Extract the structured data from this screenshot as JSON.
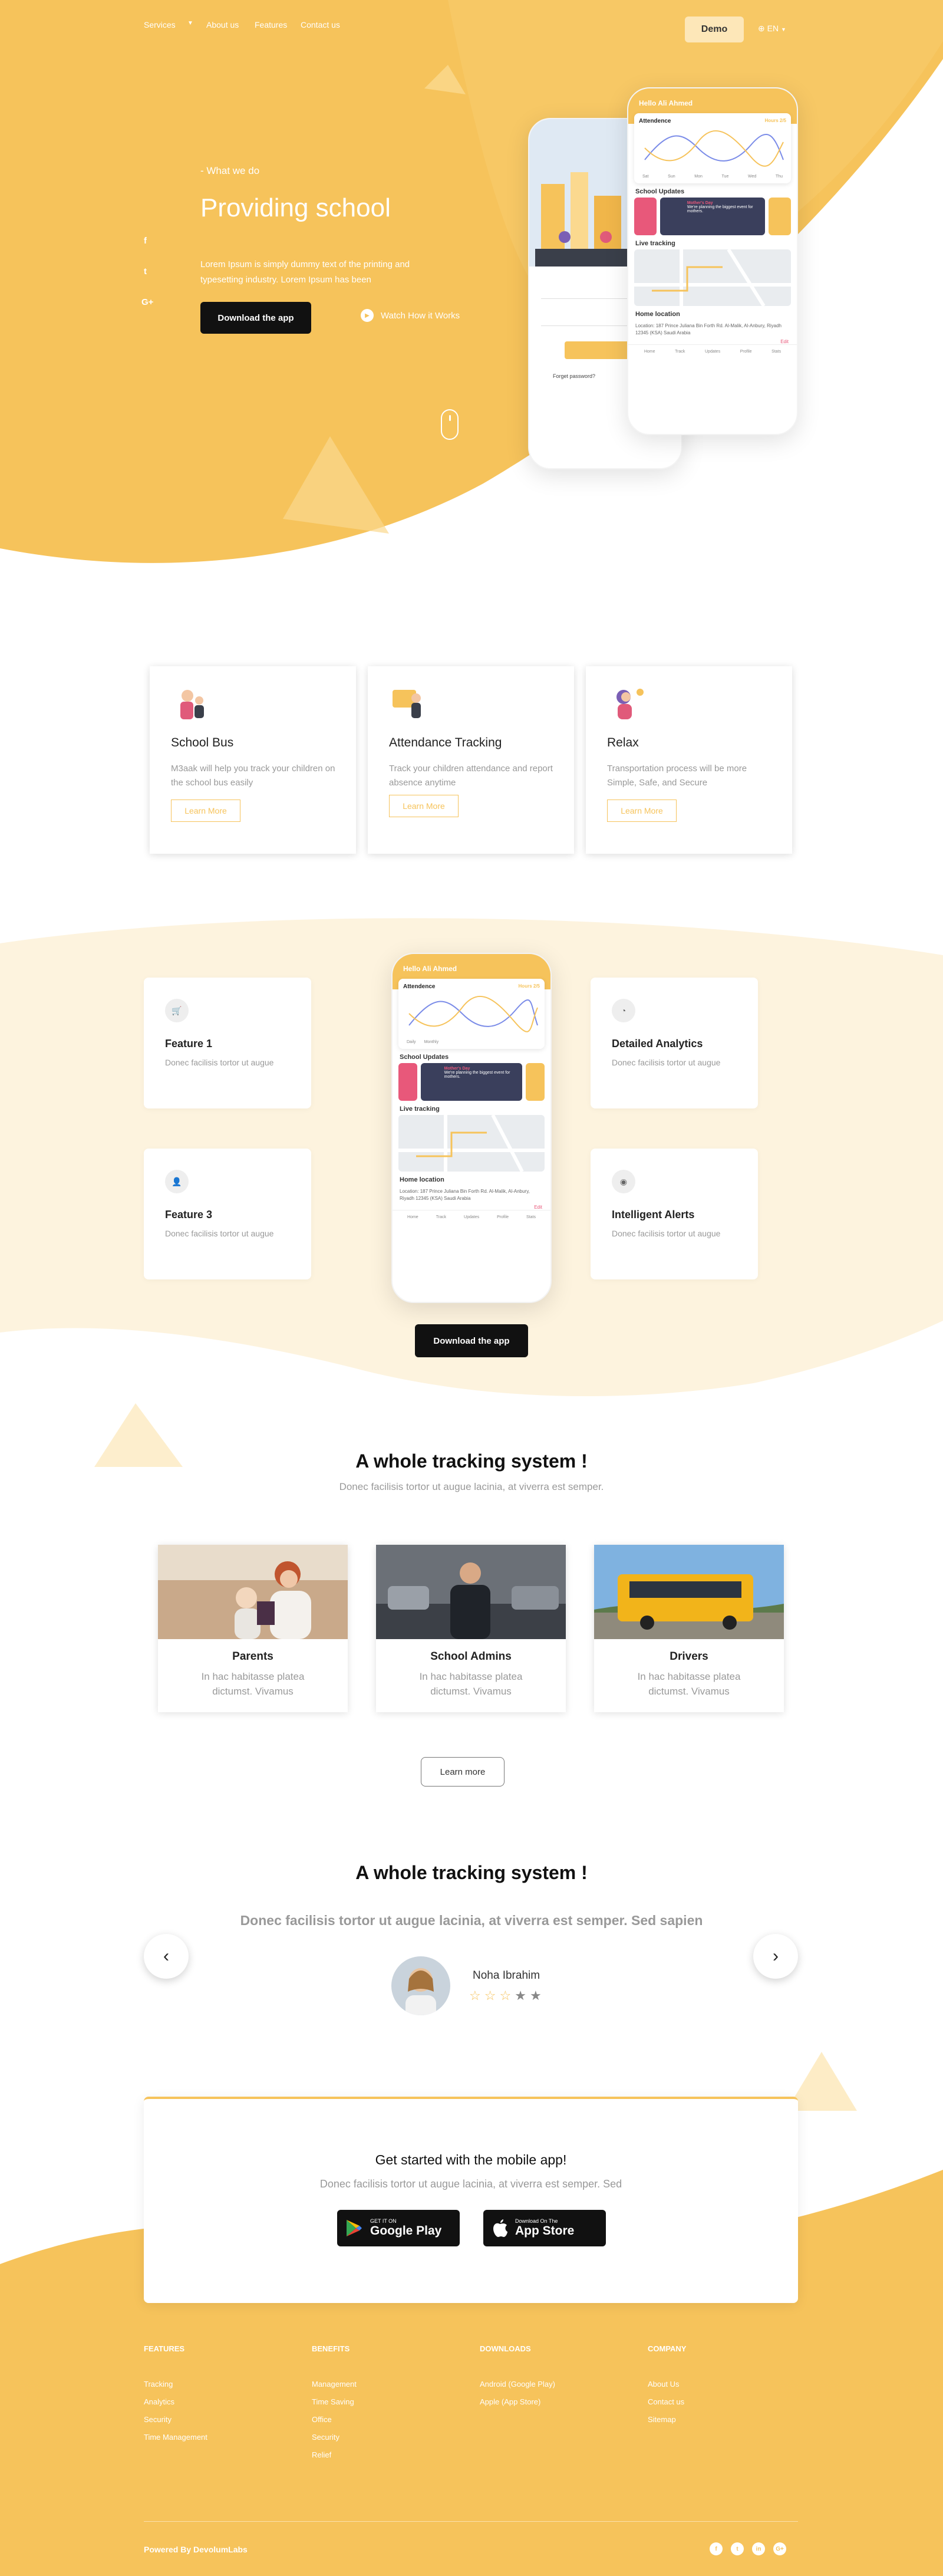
{
  "colors": {
    "accent": "#f6c35b",
    "dark": "#111111",
    "muted": "#999999"
  },
  "nav": {
    "items": [
      "Services",
      "About us",
      "Features",
      "Contact us"
    ],
    "demo_label": "Demo",
    "lang_label": "EN"
  },
  "hero": {
    "eyebrow": "- What we do",
    "title": "Providing school",
    "description": "Lorem Ipsum is simply dummy text of the printing and typesetting industry. Lorem Ipsum has been",
    "download_label": "Download the app",
    "watch_label": "Watch How it Works",
    "social": [
      "f",
      "t",
      "G+"
    ]
  },
  "login_phone": {
    "login_label": "LOGIN",
    "forgot_label": "Forget password?"
  },
  "app_screen": {
    "greeting": "Hello Ali Ahmed",
    "attendance_label": "Attendence",
    "attendance_badge": "Hours 2/5",
    "updates_label": "School Updates",
    "event_title": "Mother's Day",
    "event_text": "We're planning the biggest event for mothers.",
    "tracking_label": "Live tracking",
    "home_location_label": "Home location",
    "address": "Location: 187 Prince Juliana Bin Forth Rd. Al-Malik, Al-Anbury, Riyadh 12345 (KSA) Saudi Arabia",
    "edit_label": "Edit",
    "days": [
      "Sat",
      "Sun",
      "Mon",
      "Tue",
      "Wed",
      "Thu"
    ],
    "legend": [
      "Daily",
      "Monthly"
    ],
    "tabs": [
      "Home",
      "Track",
      "Updates",
      "Profile",
      "Stats"
    ]
  },
  "services": [
    {
      "title": "School Bus",
      "desc": "M3aak will help you track your children on the school bus easily",
      "button": "Learn More"
    },
    {
      "title": "Attendance Tracking",
      "desc": "Track your children attendance and report absence anytime",
      "button": "Learn More"
    },
    {
      "title": "Relax",
      "desc": "Transportation process will be more Simple, Safe, and Secure",
      "button": "Learn More"
    }
  ],
  "features": [
    {
      "title": "Feature 1",
      "desc": "Donec facilisis tortor ut augue"
    },
    {
      "title": "Detailed Analytics",
      "desc": "Donec facilisis tortor ut augue"
    },
    {
      "title": "Feature 3",
      "desc": "Donec facilisis tortor ut augue"
    },
    {
      "title": "Intelligent Alerts",
      "desc": "Donec facilisis tortor ut augue"
    }
  ],
  "features_download": "Download the app",
  "tracking": {
    "title": "A whole tracking system !",
    "subtitle": "Donec facilisis tortor ut augue lacinia, at viverra est semper.",
    "cards": [
      {
        "title": "Parents",
        "desc": "In hac habitasse platea dictumst. Vivamus"
      },
      {
        "title": "School Admins",
        "desc": "In hac habitasse platea dictumst. Vivamus"
      },
      {
        "title": "Drivers",
        "desc": "In hac habitasse platea dictumst. Vivamus"
      }
    ],
    "learn_more": "Learn more"
  },
  "testimonial": {
    "title": "A whole tracking system !",
    "quote": "Donec facilisis tortor ut augue lacinia, at viverra est semper. Sed sapien",
    "name": "Noha Ibrahim",
    "rating": 3,
    "rating_max": 5
  },
  "cta": {
    "title": "Get started with the mobile app!",
    "subtitle": "Donec facilisis tortor ut augue lacinia, at viverra est semper. Sed",
    "google_small": "GET IT ON",
    "google_big": "Google Play",
    "apple_small": "Download On The",
    "apple_big": "App Store"
  },
  "footer": {
    "columns": [
      {
        "head": "FEATURES",
        "links": [
          "Tracking",
          "Analytics",
          "Security",
          "Time Management"
        ]
      },
      {
        "head": "BENEFITS",
        "links": [
          "Management",
          "Time Saving",
          "Office",
          "Security",
          "Relief"
        ]
      },
      {
        "head": "DOWNLOADS",
        "links": [
          "Android (Google Play)",
          "Apple (App Store)"
        ]
      },
      {
        "head": "COMPANY",
        "links": [
          "About Us",
          "Contact us",
          "Sitemap"
        ]
      }
    ],
    "powered": "Powered By DevolumLabs",
    "social": [
      "f",
      "t",
      "in",
      "G+"
    ]
  }
}
